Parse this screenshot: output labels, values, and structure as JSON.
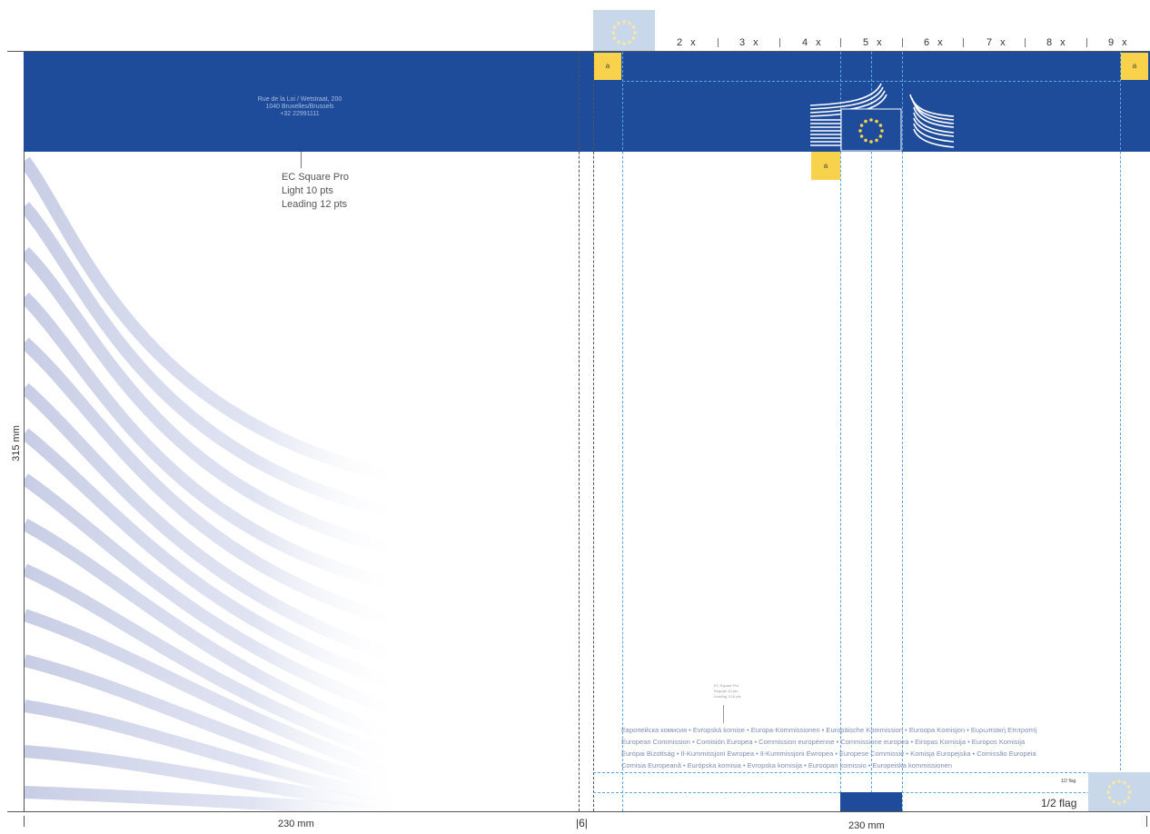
{
  "colors": {
    "eu_blue": "#1e4c9a",
    "yellow": "#f8d24b",
    "guide": "#5aa6dd"
  },
  "scale": {
    "labels": [
      "2 x",
      "3 x",
      "4 x",
      "5 x",
      "6 x",
      "7 x",
      "8 x",
      "9 x"
    ]
  },
  "address": {
    "line1": "Rue de la Loi / Wetstraat, 200",
    "line2": "1040 Bruxelles/Brussels",
    "line3": "+32 22991111"
  },
  "font_spec": {
    "line1": "EC Square Pro",
    "line2": "Light 10 pts",
    "line3": "Leading 12 pts"
  },
  "small_spec": {
    "line1": "EC Square Pro",
    "line2": "Regular 10 pts",
    "line3": "Leading 14,6 pts"
  },
  "marker": "a",
  "multilingual": {
    "line1": "Европейска комисия • Evropská komise • Europa-Kommissionen • Europäische Kommission • Euroopa Komisjon • Ευρωπαϊκή Επιτροπή",
    "line2": "European Commission • Comisión Europea • Commission européenne • Commissione europea • Eiropas Komisija • Europos Komisija",
    "line3": "Európai Bizottság • Il-Kummissjoni Ewropea • Il-Kummissjoni Ewropea • Europese Commissie • Komisja Europejska • Comissão Europeia",
    "line4": "Comisia Europeană • Európska komisia • Evropska komisija • Euroopan komissio • Europeiska kommissionen"
  },
  "half_flag": {
    "label": "1/2 flag",
    "small_label": "1/2 flag"
  },
  "dims": {
    "height": "315 mm",
    "left_width": "230 mm",
    "spine": "|6|",
    "right_width": "230 mm"
  }
}
